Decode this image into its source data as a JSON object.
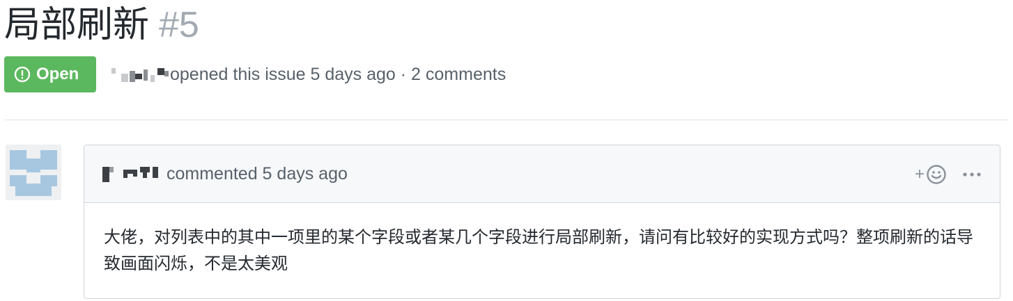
{
  "issue": {
    "title": "局部刷新",
    "number": "#5"
  },
  "state_badge": {
    "label": "Open",
    "icon": "issue-opened-icon",
    "color": "#5bb85e"
  },
  "meta": {
    "author": "[pixelated username]",
    "text": "opened this issue 5 days ago · 2 comments"
  },
  "comment": {
    "author": "[pixelated username]",
    "meta_text": "commented 5 days ago",
    "reaction_plus": "+",
    "body": "大佬，对列表中的其中一项里的某个字段或者某几个字段进行局部刷新，请问有比较好的实现方式吗？整项刷新的话导致画面闪烁，不是太美观"
  },
  "colors": {
    "muted_text": "#586069",
    "border": "#d1d5da",
    "header_bg": "#f6f8fa"
  }
}
